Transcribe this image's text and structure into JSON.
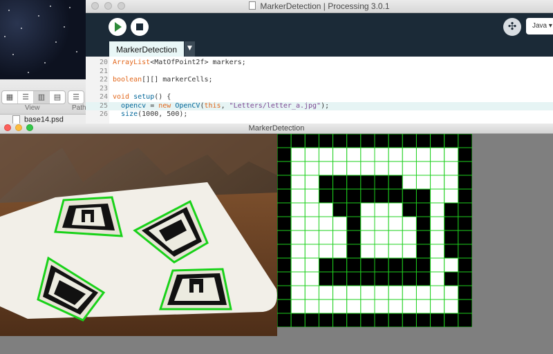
{
  "editor": {
    "title": "MarkerDetection | Processing 3.0.1",
    "run_icon": "play-icon",
    "stop_icon": "stop-icon",
    "debug_icon": "butterfly-icon",
    "mode_label": "Java ▾",
    "tab_label": "MarkerDetection",
    "tab_menu": "▼"
  },
  "code_lines": [
    {
      "num": "20",
      "text": "ArrayList<MatOfPoint2f> markers;"
    },
    {
      "num": "21",
      "text": ""
    },
    {
      "num": "22",
      "text": "boolean[][] markerCells;"
    },
    {
      "num": "23",
      "text": ""
    },
    {
      "num": "24",
      "text": "void setup() {"
    },
    {
      "num": "25",
      "text": "  opencv = new OpenCV(this, \"Letters/letter_a.jpg\");"
    },
    {
      "num": "26",
      "text": "  size(1000, 500);"
    }
  ],
  "finder": {
    "view_label": "View",
    "path_label": "Path",
    "file_name": "base14.psd"
  },
  "sketch": {
    "title": "MarkerDetection"
  },
  "marker_grid": {
    "rows": 14,
    "cols": 14,
    "cells": [
      "00000000000000",
      "01111111111110",
      "01111111111110",
      "01100000011110",
      "01100000000110",
      "01110011100100",
      "01111011110100",
      "01111011110100",
      "01111011110100",
      "01100000000110",
      "01100000000100",
      "01111111111110",
      "01111111111110",
      "00000000000000"
    ],
    "line_color": "#1ed01e",
    "on_color": "#ffffff",
    "off_color": "#000000"
  }
}
